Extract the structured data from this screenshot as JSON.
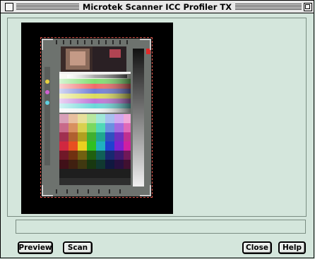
{
  "window": {
    "title": "Microtek Scanner ICC Profiler TX"
  },
  "preview": {
    "target_image_alt": "IT8 color calibration target scan"
  },
  "status": {
    "text": ""
  },
  "buttons": {
    "preview": "Preview",
    "scan": "Scan",
    "close": "Close",
    "help": "Help"
  },
  "colors": {
    "window_bg": "#d4e6dc",
    "marquee": "#e0584f"
  }
}
